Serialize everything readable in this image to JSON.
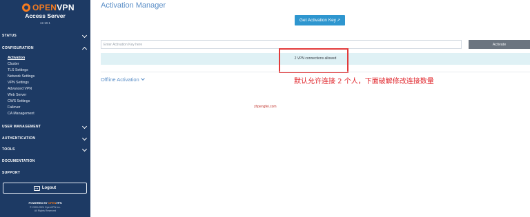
{
  "brand": {
    "logo_open": "OPEN",
    "logo_vpn": "VPN",
    "subtitle": "Access Server",
    "version": "v2.10.1"
  },
  "nav": {
    "status": "STATUS",
    "configuration": "CONFIGURATION",
    "config_items": [
      "Activation",
      "Cluster",
      "TLS Settings",
      "Network Settings",
      "VPN Settings",
      "Advanced VPN",
      "Web Server",
      "CWS Settings",
      "Failover",
      "CA Management"
    ],
    "user_management": "USER MANAGEMENT",
    "authentication": "AUTHENTICATION",
    "tools": "TOOLS",
    "documentation": "DOCUMENTATION",
    "support": "SUPPORT"
  },
  "logout_label": "Logout",
  "footer": {
    "powered_prefix": "POWERED BY",
    "powered_brand_open": "OPEN",
    "powered_brand_vpn": "VPN",
    "copyright": "© 2009-2024 OpenVPN Inc.",
    "rights": "All Rights Reserved"
  },
  "main": {
    "title": "Activation Manager",
    "get_key_label": "Get Activation Key",
    "input_placeholder": "Enter Activation Key here",
    "activate_label": "Activate",
    "connections_text": "2 VPN connections allowed",
    "offline_label": "Offline Activation"
  },
  "annotation": "默认允许连接 2 个人，下面破解修改连接数量",
  "watermark": "zhpengfei.com",
  "colors": {
    "sidebar_bg": "#1d3a64",
    "brand_orange": "#f47b20",
    "accent_blue": "#2e96cf",
    "highlight_red": "#e23a3a"
  }
}
